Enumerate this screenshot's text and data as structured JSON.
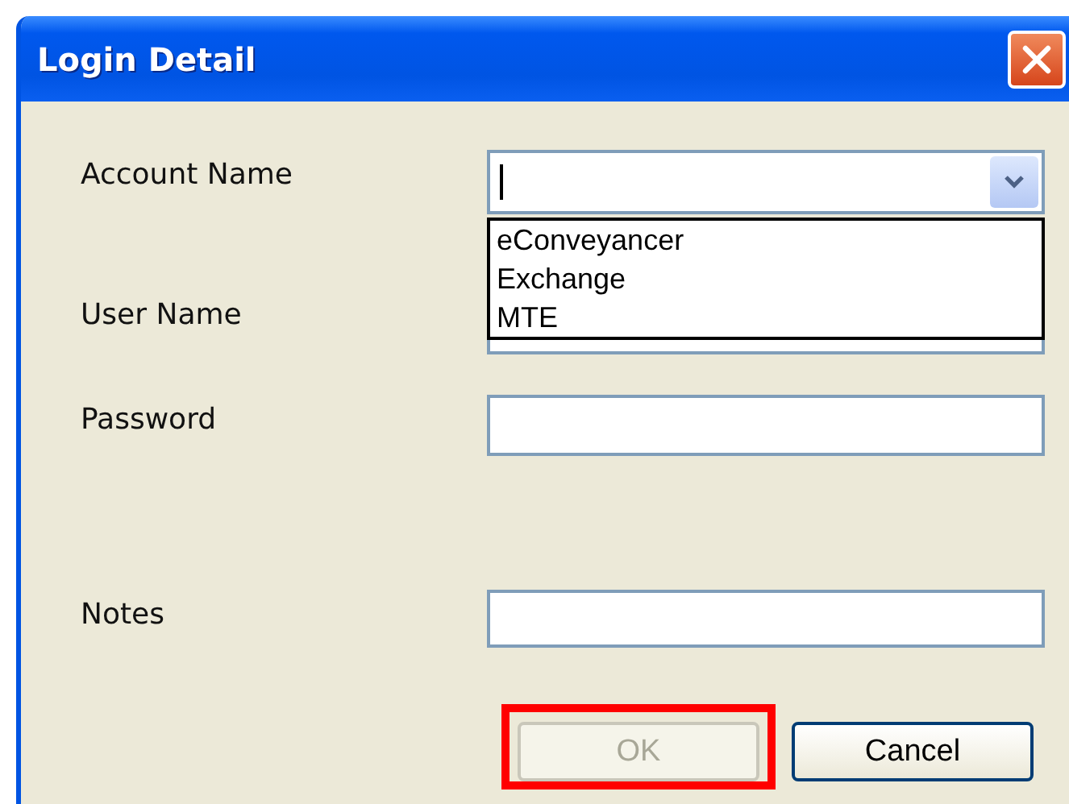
{
  "window": {
    "title": "Login Detail"
  },
  "fields": [
    {
      "label": "Account Name",
      "kind": "combo",
      "focused": true,
      "expanded": true,
      "options": [
        "eConveyancer",
        "Exchange",
        "MTE"
      ]
    },
    {
      "label": "User Name",
      "kind": "text",
      "focused": false
    },
    {
      "label": "Password",
      "kind": "password",
      "focused": false
    },
    {
      "label": "Notes",
      "kind": "text",
      "focused": false
    }
  ],
  "buttons": [
    {
      "label": "OK",
      "disabled": true,
      "highlighted": true
    },
    {
      "label": "Cancel",
      "disabled": false,
      "highlighted": false
    }
  ]
}
